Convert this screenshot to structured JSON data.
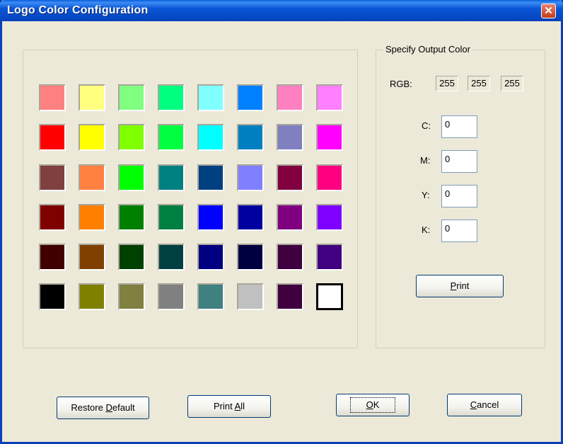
{
  "window": {
    "title": "Logo Color Configuration",
    "close_symbol": "✕"
  },
  "output_group": {
    "label": "Specify Output Color",
    "rgb_label": "RGB:",
    "rgb_values": [
      "255",
      "255",
      "255"
    ],
    "cmyk": [
      {
        "label": "C:",
        "value": "0"
      },
      {
        "label": "M:",
        "value": "0"
      },
      {
        "label": "Y:",
        "value": "0"
      },
      {
        "label": "K:",
        "value": "0"
      }
    ],
    "print_label": "Print",
    "print_mnemonic": "P"
  },
  "buttons": {
    "restore_default": {
      "label": "Restore Default",
      "mnemonic": "D"
    },
    "print_all": {
      "label": "Print All",
      "mnemonic": "A"
    },
    "ok": {
      "label": "OK",
      "mnemonic": "O"
    },
    "cancel": {
      "label": "Cancel",
      "mnemonic": "C"
    }
  },
  "palette": {
    "selected_index": 47,
    "colors": [
      "#FF8080",
      "#FFFF80",
      "#80FF80",
      "#00FF80",
      "#80FFFF",
      "#0080FF",
      "#FF80C0",
      "#FF80FF",
      "#FF0000",
      "#FFFF00",
      "#80FF00",
      "#00FF40",
      "#00FFFF",
      "#0080C0",
      "#8080C0",
      "#FF00FF",
      "#804040",
      "#FF8040",
      "#00FF00",
      "#008080",
      "#004080",
      "#8080FF",
      "#800040",
      "#FF0080",
      "#800000",
      "#FF8000",
      "#008000",
      "#008040",
      "#0000FF",
      "#0000A0",
      "#800080",
      "#8000FF",
      "#400000",
      "#804000",
      "#004000",
      "#004040",
      "#000080",
      "#000040",
      "#400040",
      "#400080",
      "#000000",
      "#808000",
      "#808040",
      "#808080",
      "#408080",
      "#C0C0C0",
      "#400040",
      "#FFFFFF"
    ]
  }
}
